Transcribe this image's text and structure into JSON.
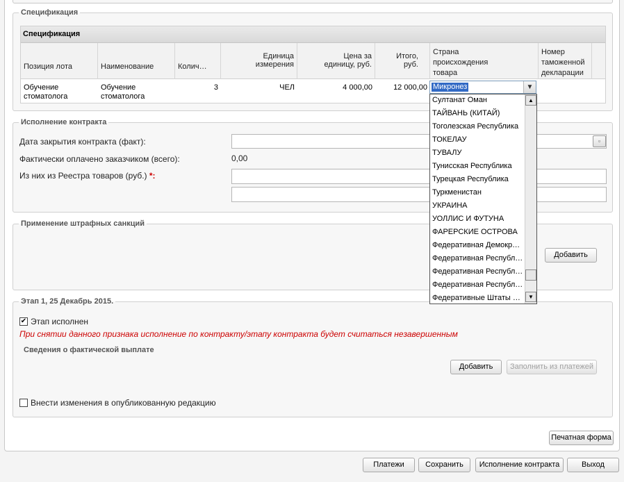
{
  "spec_fieldset": {
    "legend": "Спецификация"
  },
  "grid": {
    "title": "Спецификация",
    "columns": [
      "Позиция лота",
      "Наименование",
      "Колич…",
      "Единица измерения",
      "Цена за единицу, руб.",
      "Итого, руб.",
      "Страна происхождения товара",
      "Номер таможенной декларации"
    ],
    "row": {
      "position": "Обучение стоматолога",
      "name": "Обучение стоматолога",
      "quantity": "3",
      "unit": "ЧЕЛ",
      "price": "4 000,00",
      "total": "12 000,00"
    }
  },
  "country_combo": {
    "value": "Микронез",
    "options": [
      "Султанат Оман",
      "ТАЙВАНЬ (КИТАЙ)",
      "Тоголезская Республика",
      "ТОКЕЛАУ",
      "ТУВАЛУ",
      "Тунисская Республика",
      "Турецкая Республика",
      "Туркменистан",
      "УКРАИНА",
      "УОЛЛИС И ФУТУНА",
      "ФАРЕРСКИЕ ОСТРОВА",
      "Федеративная Демокр…",
      "Федеративная Республ…",
      "Федеративная Республ…",
      "Федеративная Республ…",
      "Федеративные Штаты …"
    ]
  },
  "execution": {
    "legend": "Исполнение контракта",
    "close_date_label": "Дата закрытия контракта (факт):",
    "paid_label": "Фактически оплачено заказчиком (всего):",
    "paid_value": "0,00",
    "registry_label": "Из них из Реестра товаров (руб.)",
    "required_mark": "*:"
  },
  "penalties": {
    "legend": "Применение штрафных санкций",
    "add_label": "Добавить"
  },
  "stage": {
    "legend": "Этап 1, 25 Декабрь 2015.",
    "done_label": "Этап исполнен",
    "warning": "При снятии данного признака исполнение по контракту/этапу контракта будет считаться незавершенным",
    "payment_info": "Сведения о фактической выплате",
    "add_label": "Добавить",
    "fill_label": "Заполнить из платежей",
    "edit_published_label": "Внести изменения в опубликованную редакцию"
  },
  "print_form_label": "Печатная форма",
  "footer": {
    "payments": "Платежи",
    "save": "Сохранить",
    "execution": "Исполнение контракта",
    "exit": "Выход"
  },
  "icons": {
    "calendar": "calendar-icon",
    "dropdown": "chevron-down-icon"
  }
}
